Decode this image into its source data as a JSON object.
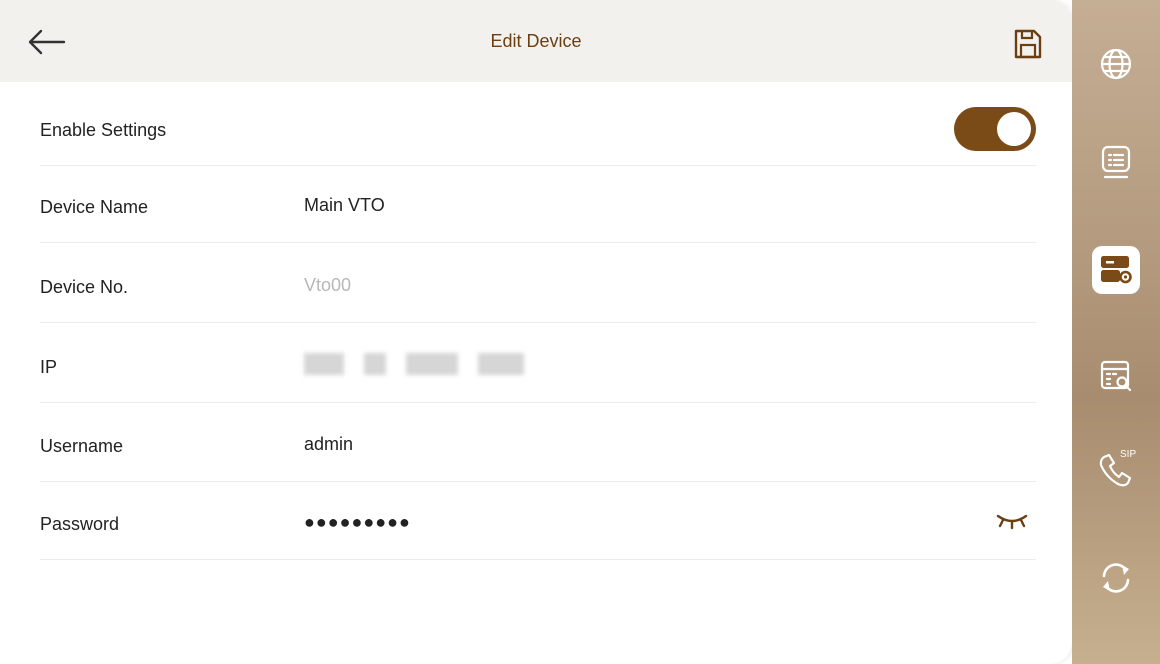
{
  "header": {
    "title": "Edit Device",
    "back_icon": "arrow-left-icon",
    "save_icon": "floppy-disk-icon"
  },
  "form": {
    "enable": {
      "label": "Enable Settings",
      "checked": true
    },
    "device_name": {
      "label": "Device Name",
      "value": "Main VTO"
    },
    "device_no": {
      "label": "Device No.",
      "value": "Vto00"
    },
    "ip": {
      "label": "IP"
    },
    "username": {
      "label": "Username",
      "value": "admin"
    },
    "password": {
      "label": "Password",
      "value": "●●●●●●●●●",
      "reveal_icon": "eye-closed-icon"
    }
  },
  "sidebar": {
    "items": [
      {
        "name": "network",
        "icon": "globe-icon",
        "active": false
      },
      {
        "name": "device-list",
        "icon": "list-screen-icon",
        "active": false
      },
      {
        "name": "device-settings",
        "icon": "device-gear-icon",
        "active": true
      },
      {
        "name": "device-search",
        "icon": "list-search-icon",
        "active": false
      },
      {
        "name": "sip",
        "icon": "phone-sip-icon",
        "label": "SIP",
        "active": false
      },
      {
        "name": "sync",
        "icon": "refresh-icon",
        "active": false
      }
    ]
  },
  "colors": {
    "accent": "#7a4a17",
    "header_bg": "#f3f1ee",
    "title_text": "#6b3f12",
    "muted_text": "#b8b8b8",
    "sidebar_icon": "#ffffff"
  }
}
